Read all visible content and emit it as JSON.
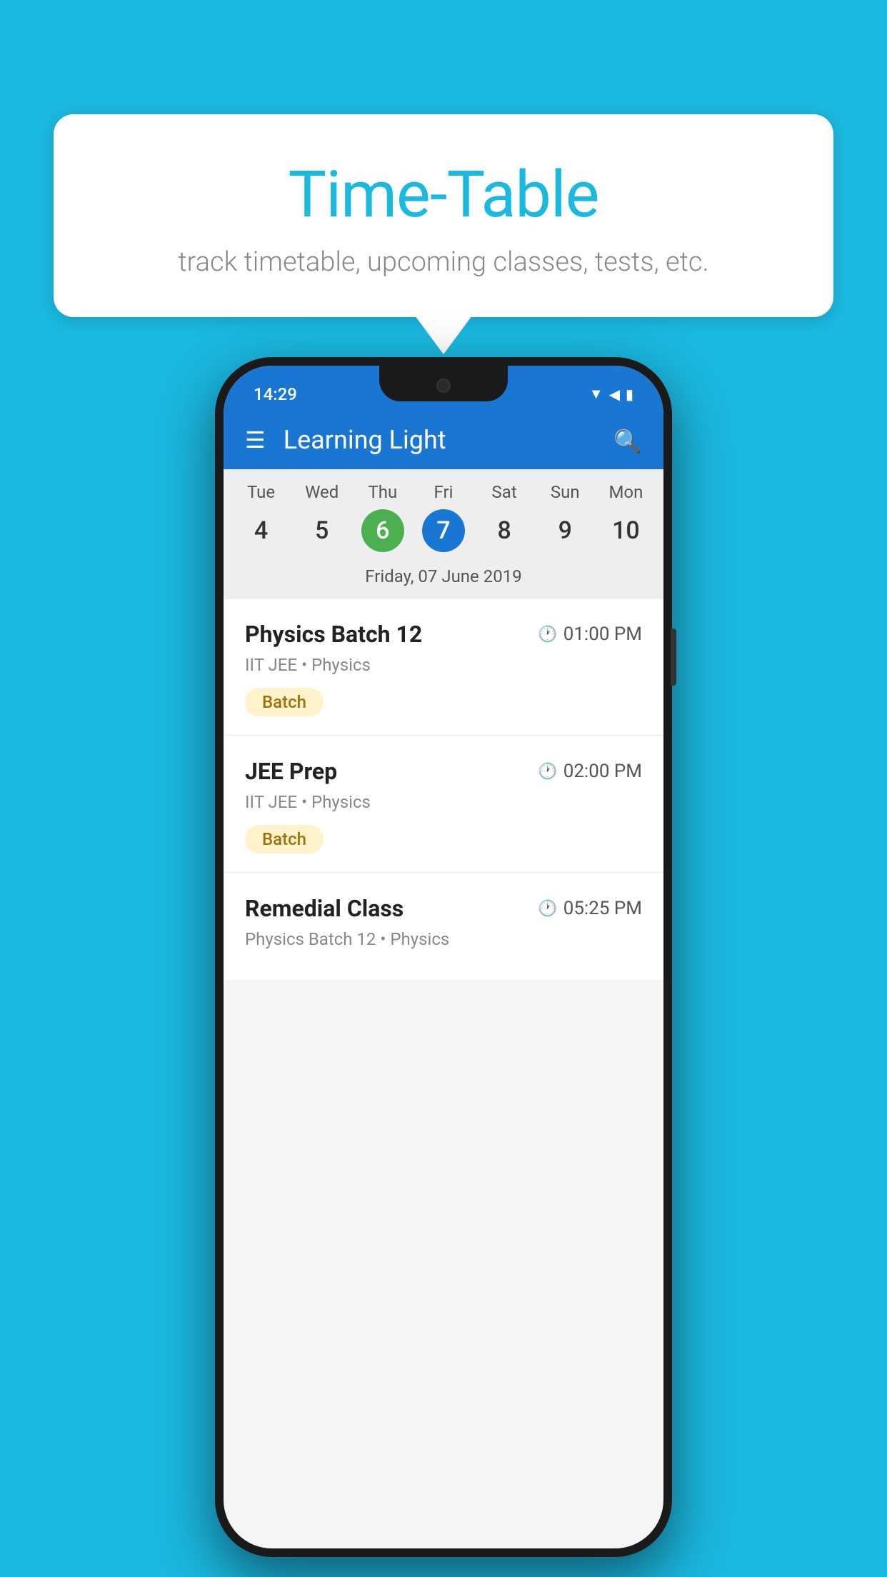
{
  "background": {
    "color": "#1BB8E0"
  },
  "speech_bubble": {
    "title": "Time-Table",
    "subtitle": "track timetable, upcoming classes, tests, etc."
  },
  "phone": {
    "status_bar": {
      "time": "14:29"
    },
    "app_bar": {
      "title": "Learning Light",
      "menu_icon": "☰",
      "search_icon": "🔍"
    },
    "calendar": {
      "days": [
        {
          "name": "Tue",
          "num": "4",
          "state": "normal"
        },
        {
          "name": "Wed",
          "num": "5",
          "state": "normal"
        },
        {
          "name": "Thu",
          "num": "6",
          "state": "today"
        },
        {
          "name": "Fri",
          "num": "7",
          "state": "selected"
        },
        {
          "name": "Sat",
          "num": "8",
          "state": "normal"
        },
        {
          "name": "Sun",
          "num": "9",
          "state": "normal"
        },
        {
          "name": "Mon",
          "num": "10",
          "state": "normal"
        }
      ],
      "selected_date_label": "Friday, 07 June 2019"
    },
    "classes": [
      {
        "name": "Physics Batch 12",
        "time": "01:00 PM",
        "meta": "IIT JEE • Physics",
        "badge": "Batch"
      },
      {
        "name": "JEE Prep",
        "time": "02:00 PM",
        "meta": "IIT JEE • Physics",
        "badge": "Batch"
      },
      {
        "name": "Remedial Class",
        "time": "05:25 PM",
        "meta": "Physics Batch 12 • Physics",
        "badge": null
      }
    ]
  }
}
